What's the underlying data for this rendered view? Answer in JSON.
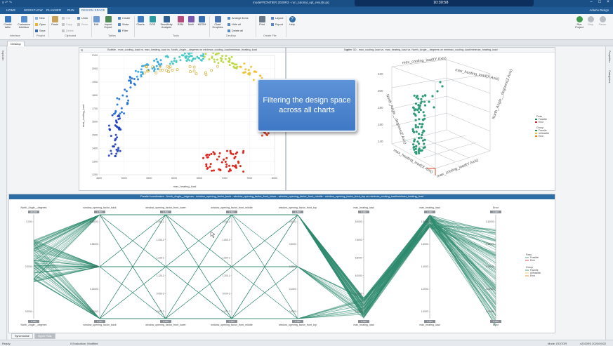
{
  "titlebar": {
    "app_title": "modeFRONTIER 2020R3 - run_tutorial_opt_results.prj",
    "time": "10:30:58",
    "quick_access": "≡ ↶ ↷"
  },
  "menu": {
    "tabs": [
      "HOME",
      "WORKFLOW",
      "PLANNER",
      "RUN",
      "DESIGN SPACE"
    ],
    "active": "DESIGN SPACE",
    "user": "Adamo Design"
  },
  "ribbon": {
    "create_table": "Create\ntable",
    "customize_interface": "Customize\nInterface",
    "new": "New",
    "open": "Open",
    "save": "Save",
    "paste": "Paste",
    "cut": "Cut",
    "copy": "Copy",
    "delete": "Delete",
    "undo": "Undo",
    "redo": "Redo",
    "edit": "Edit",
    "import_export": "Import\nExport",
    "create": "Create",
    "scale": "Scale",
    "filter": "Filter",
    "charts": "Charts",
    "doe": "DOE",
    "sensitivity": "Sensitivity\nAnalysis",
    "rsm": "RSM",
    "mcdm": "MCDM",
    "multi": "Multi",
    "chart_graphics": "Chart\nGraphics",
    "arrange_items": "Arrange items",
    "hide_all": "Hide all",
    "delete_all": "Delete all",
    "print": "Print",
    "layout": "Layout",
    "export": "Export",
    "help": "Help",
    "run_project": "Run\nProject",
    "stop": "Stop",
    "pause": "Pause",
    "groups": [
      "Interface",
      "Project",
      "Clipboard",
      "Tables",
      "Tools",
      "Desktop",
      "Create File"
    ]
  },
  "desktop_tab": "Desktop",
  "side": {
    "left": "Explorer",
    "right_top": "Properties",
    "right_bottom": "Categories"
  },
  "bubble": {
    "title": "Bubble - max_cooling_load vs. max_heating_load vs. North_Angle__degrees  on minimax_cooling_load/minimax_heating_load",
    "x_label": "max_heating_load",
    "y_label": "max_cooling_load",
    "x_ticks": [
      "4500",
      "5000",
      "5500",
      "6000",
      "6500",
      "7000",
      "7500",
      "8000"
    ],
    "y_ticks": [
      "1200",
      "1300",
      "1400",
      "1500",
      "1600",
      "1700",
      "1800",
      "1900",
      "2000",
      "2100"
    ]
  },
  "scatter3d": {
    "title": "Scatter 3D - max_cooling_load vs. max_heating_load vs. North_Angle__degrees  on minimax_cooling_load/minimax_heating_load",
    "z_axis": "max_cooling_load(Y Axis)",
    "x_axis": "max_heating_load(X Axis)",
    "north_axis": "North_Angle__degrees(Z Axis)",
    "left_ticks": [
      "220",
      "200",
      "180",
      "160",
      "140"
    ],
    "legend": {
      "feas_title": "Feas",
      "feasible": "Feasible",
      "error": "Error",
      "group_title": "Group",
      "favorite": "Favorite",
      "unfeasible": "Unfeasible",
      "error2": "Error"
    }
  },
  "callout": "Filtering the design space across all charts",
  "parallel": {
    "title": "Parallel coordinates - North_Angle__degrees - window_opening_factor_back - window_opening_factor_front_lower - window_opening_factor_front_middle - window_opening_factor_front_top on minimax_cooling_load/minimax_heating_load",
    "axes": [
      {
        "name": "North_Angle__degrees",
        "top": "90.000",
        "bottom": "0.000",
        "ticks": [
          "0.000",
          "2.0000",
          "3.0000"
        ]
      },
      {
        "name": "window_opening_factor_back",
        "top": "0.500",
        "bottom": "0.000",
        "ticks": [
          "0.45000",
          "0.36000",
          "0.25000",
          "0.14000",
          "0.03000"
        ]
      },
      {
        "name": "window_opening_factor_front_lower",
        "top": "0.500",
        "bottom": "0.000",
        "ticks": [
          "1.450-1",
          "1.330-1",
          "1.225-1",
          "1.120-1",
          "9.050-2",
          "8.000-2"
        ]
      },
      {
        "name": "window_opening_factor_front_middle",
        "top": "0.500",
        "bottom": "0.000",
        "ticks": [
          "2.000-1",
          "1.800-1",
          "1.500-1",
          "1.200-1",
          "9.000-2",
          "6.000-2"
        ]
      },
      {
        "name": "window_opening_factor_front_top",
        "top": "0.500",
        "bottom": "0.000",
        "ticks": [
          "0.4000",
          "0.3000",
          "0.2500",
          "0.1500",
          "0.0500"
        ]
      },
      {
        "name": "max_heating_load",
        "top": "0.000",
        "bottom": "0.000",
        "ticks": [
          "8.4000",
          "7.6000",
          "6.8000",
          "6.0000",
          "5.2000",
          "4.4000"
        ]
      },
      {
        "name": "max_heating_load",
        "top": "0.000",
        "bottom": "0.000",
        "ticks": [
          "1.8000",
          "1.6000",
          "1.4000",
          "1.2000",
          "1.0000"
        ]
      },
      {
        "name": "Error",
        "top": "0.000",
        "bottom": "0.000",
        "ticks": [
          "0.10000",
          "0.08000",
          "0.06000",
          "0.04000",
          "0.02000"
        ]
      }
    ],
    "legend": {
      "feas_title": "Feas",
      "feasible": "Feasible",
      "error": "Error",
      "group_title": "Group",
      "favorite": "Favorite",
      "unfeasible": "Unfeasible",
      "error2": "Error"
    }
  },
  "bottom_tabs": [
    "Synchronise",
    "Hyper Plots"
  ],
  "status": {
    "left": "Ready",
    "middle": "0 Evaluation: Modified",
    "right1": "Mode: EDITOR",
    "right2": "v2020R3 2020/09/22"
  },
  "colors": {
    "accent": "#1f5a95",
    "parallel_line": "#2e8b6e",
    "favorite": "#1a8f5a",
    "error": "#e02020",
    "unfeasible": "#e4c13a"
  }
}
